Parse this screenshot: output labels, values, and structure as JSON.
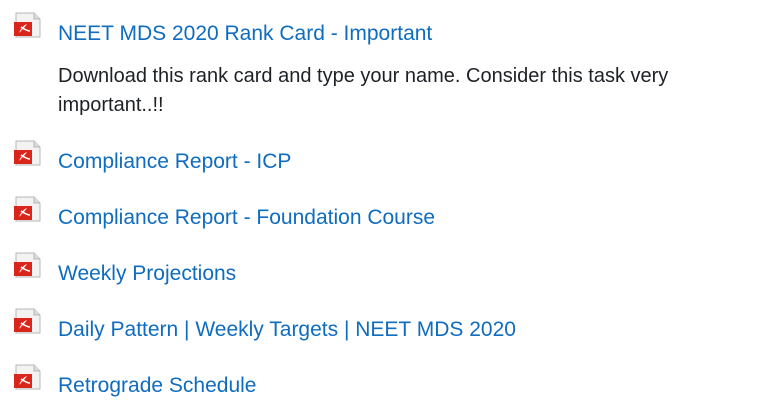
{
  "icons": {
    "resource_icon": "pdf-document-icon",
    "accent_color": "#d9261c",
    "link_color": "#0f6cbf"
  },
  "resources": [
    {
      "title": "NEET MDS 2020 Rank Card - Important",
      "description": "Download this rank card and type your name. Consider this task very important..!!"
    },
    {
      "title": "Compliance Report - ICP"
    },
    {
      "title": "Compliance Report - Foundation Course"
    },
    {
      "title": "Weekly Projections"
    },
    {
      "title": "Daily Pattern | Weekly Targets | NEET MDS 2020"
    },
    {
      "title": "Retrograde Schedule"
    }
  ]
}
